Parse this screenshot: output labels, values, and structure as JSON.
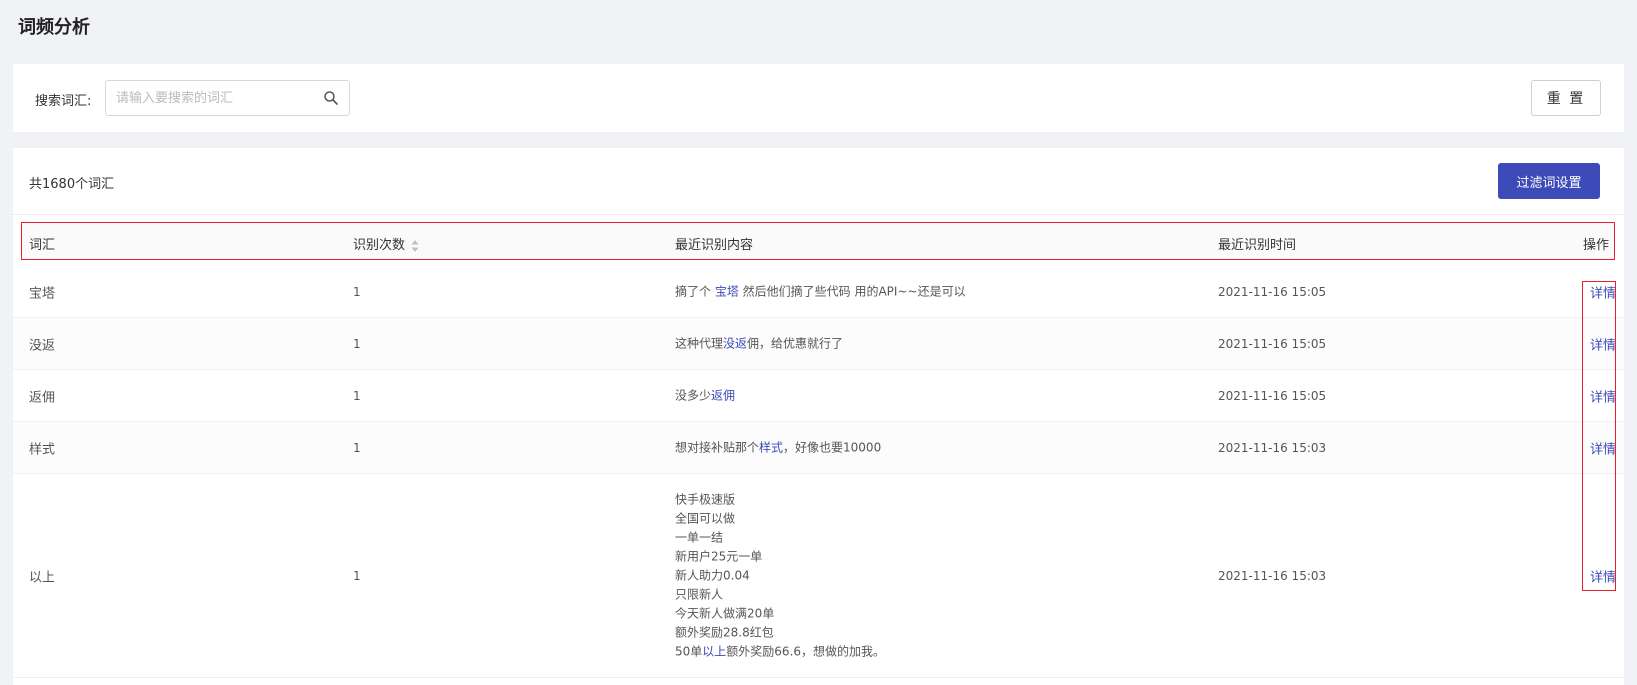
{
  "page": {
    "title": "词频分析"
  },
  "search": {
    "label": "搜索词汇:",
    "placeholder": "请输入要搜索的词汇",
    "value": "",
    "reset_label": "重 置"
  },
  "table": {
    "total_text": "共1680个词汇",
    "filter_label": "过滤词设置",
    "columns": {
      "word": "词汇",
      "count": "识别次数",
      "content": "最近识别内容",
      "time": "最近识别时间",
      "op": "操作"
    },
    "rows": [
      {
        "word": "宝塔",
        "count": "1",
        "content": [
          {
            "text": "摘了个 ",
            "hl": false
          },
          {
            "text": "宝塔",
            "hl": true
          },
          {
            "text": " 然后他们摘了些代码 用的API~~还是可以",
            "hl": false
          }
        ],
        "time": "2021-11-16 15:05",
        "op": "详情"
      },
      {
        "word": "没返",
        "count": "1",
        "content": [
          {
            "text": "这种代理",
            "hl": false
          },
          {
            "text": "没返",
            "hl": true
          },
          {
            "text": "佣，给优惠就行了",
            "hl": false
          }
        ],
        "time": "2021-11-16 15:05",
        "op": "详情"
      },
      {
        "word": "返佣",
        "count": "1",
        "content": [
          {
            "text": "没多少",
            "hl": false
          },
          {
            "text": "返佣",
            "hl": true
          }
        ],
        "time": "2021-11-16 15:05",
        "op": "详情"
      },
      {
        "word": "样式",
        "count": "1",
        "content": [
          {
            "text": "想对接补贴那个",
            "hl": false
          },
          {
            "text": "样式",
            "hl": true
          },
          {
            "text": "，好像也要10000",
            "hl": false
          }
        ],
        "time": "2021-11-16 15:03",
        "op": "详情"
      },
      {
        "word": "以上",
        "count": "1",
        "content_lines": [
          [
            {
              "text": "快手极速版",
              "hl": false
            }
          ],
          [
            {
              "text": "全国可以做",
              "hl": false
            }
          ],
          [
            {
              "text": "一单一结",
              "hl": false
            }
          ],
          [
            {
              "text": "新用户25元一单",
              "hl": false
            }
          ],
          [
            {
              "text": "新人助力0.04",
              "hl": false
            }
          ],
          [
            {
              "text": "只限新人",
              "hl": false
            }
          ],
          [
            {
              "text": "今天新人做满20单",
              "hl": false
            }
          ],
          [
            {
              "text": "额外奖励28.8红包",
              "hl": false
            }
          ],
          [
            {
              "text": "50单",
              "hl": false
            },
            {
              "text": "以上",
              "hl": true
            },
            {
              "text": "额外奖励66.6，想做的加我。",
              "hl": false
            }
          ]
        ],
        "time": "2021-11-16 15:03",
        "op": "详情"
      }
    ]
  },
  "colors": {
    "accent": "#3d4bb8",
    "annotation": "#e8202a"
  }
}
